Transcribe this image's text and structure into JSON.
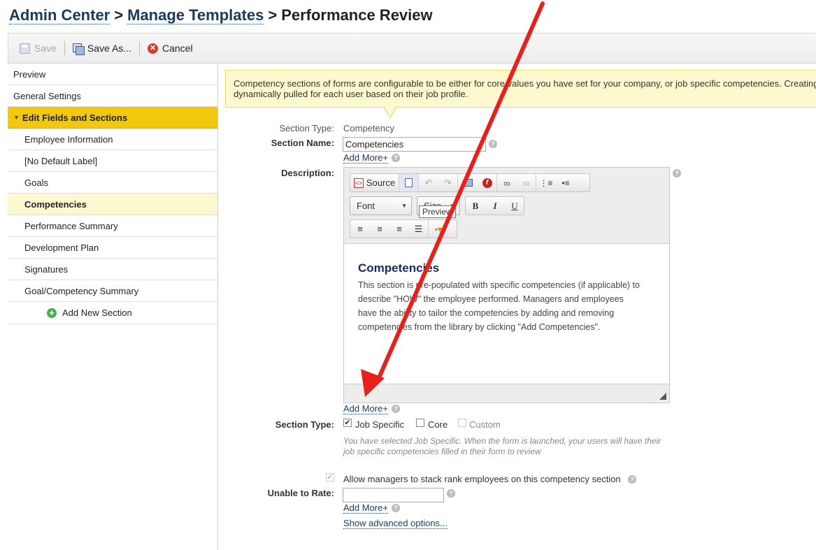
{
  "breadcrumb": {
    "admin_center": "Admin Center",
    "manage_templates": "Manage Templates",
    "separator": ">",
    "current": "Performance Review"
  },
  "toolbar": {
    "save": "Save",
    "save_as": "Save As...",
    "cancel": "Cancel"
  },
  "sidebar": {
    "preview": "Preview",
    "general_settings": "General Settings",
    "edit_fields": "Edit Fields and Sections",
    "items": [
      "Employee Information",
      "[No Default Label]",
      "Goals",
      "Competencies",
      "Performance Summary",
      "Development Plan",
      "Signatures",
      "Goal/Competency Summary"
    ],
    "add_new_section": "Add New Section"
  },
  "info": {
    "line1": "Competency sections of forms are configurable to be either for core values you have set for your company, or job specific competencies. Creating",
    "line2": "dynamically pulled for each user based on their job profile."
  },
  "form": {
    "section_type_label": "Section Type:",
    "section_type_value": "Competency",
    "section_name_label": "Section Name:",
    "section_name_value": "Competencies",
    "add_more": "Add More+",
    "description_label": "Description:",
    "section_type2_label": "Section Type:",
    "job_specific": "Job Specific",
    "core": "Core",
    "custom": "Custom",
    "note_line1": "You have selected Job Specific. When the form is launched, your users will have their",
    "note_line2": "job specific competencies filled in their form to review",
    "stack_rank": "Allow managers to stack rank employees on this competency section",
    "unable_to_rate_label": "Unable to Rate:",
    "unable_to_rate_value": "",
    "show_advanced": "Show advanced options..."
  },
  "editor": {
    "source": "Source",
    "font": "Font",
    "size": "Size",
    "tooltip": "Preview",
    "bold": "B",
    "italic": "I",
    "underline": "U",
    "heading": "Competencies",
    "line1": "This section is pre-populated with specific competencies (if applicable) to",
    "line2": "describe \"HOW\" the employee performed. Managers and employees",
    "line3": "have the ability to tailor the competencies by adding and removing",
    "line4": "competencies from the library by clicking \"Add Competencies\"."
  },
  "colors": {
    "arrow": "#e8201c",
    "selected_group": "#f2c80c",
    "info_bg": "#fdf9cf",
    "link": "#1a3a5c"
  }
}
